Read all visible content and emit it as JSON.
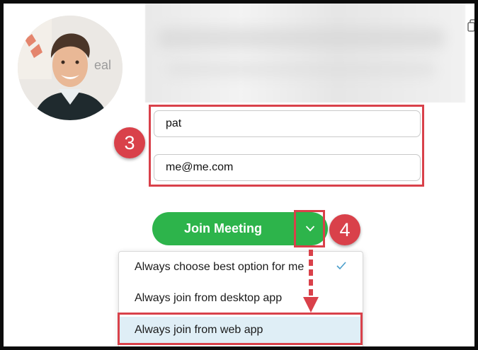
{
  "profile": {
    "avatar_icon": "person-photo"
  },
  "actions": {
    "copy_icon": "copy-icon"
  },
  "form": {
    "name_value": "pat",
    "email_value": "me@me.com"
  },
  "annotations": {
    "step3": "3",
    "step4": "4",
    "accent_color": "#d9414a"
  },
  "join": {
    "label": "Join Meeting",
    "color": "#2db44b",
    "dropdown_icon": "chevron-down-icon"
  },
  "dropdown": {
    "items": [
      {
        "label": "Always choose best option for me",
        "checked": true
      },
      {
        "label": "Always join from desktop app",
        "checked": false
      },
      {
        "label": "Always join from web app",
        "checked": false,
        "highlighted": true
      }
    ],
    "check_icon": "check-icon"
  }
}
